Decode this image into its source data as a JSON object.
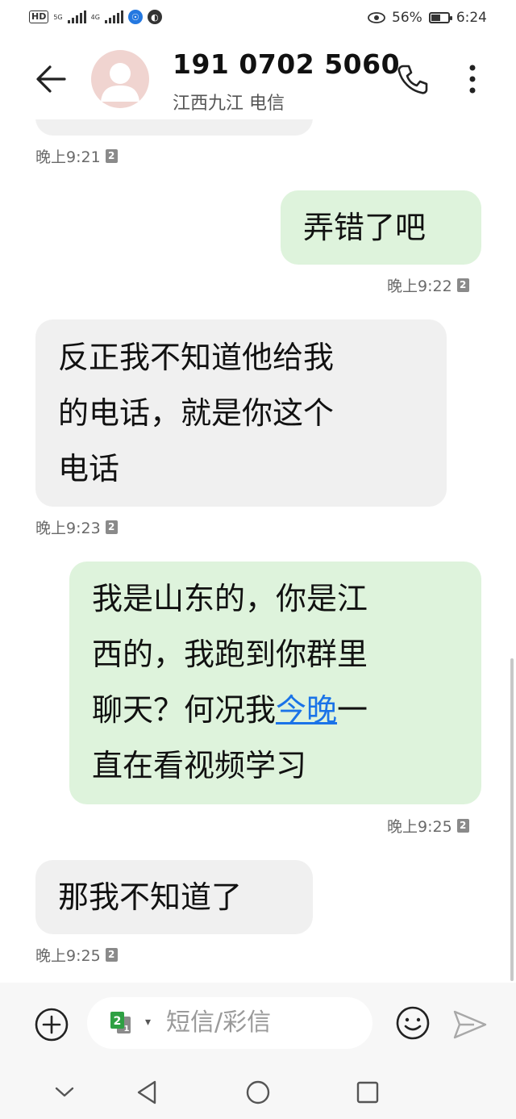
{
  "status_bar": {
    "hd": "HD",
    "net1": "5G",
    "net2": "4G",
    "battery_percent": "56%",
    "battery_level": 0.56,
    "time": "6:24"
  },
  "header": {
    "contact_number": "191 0702 5060",
    "contact_location": "江西九江 电信",
    "icons": [
      "back-arrow-icon",
      "avatar",
      "phone-icon",
      "more-vertical-icon"
    ]
  },
  "messages": [
    {
      "direction": "received",
      "text": "",
      "time": "晚上9:21",
      "sim": "2"
    },
    {
      "direction": "sent",
      "text": "弄错了吧",
      "time": "晚上9:22",
      "sim": "2"
    },
    {
      "direction": "received",
      "lines": [
        "反正我不知道他给我",
        "的电话，就是你这个",
        "电话"
      ],
      "time": "晚上9:23",
      "sim": "2"
    },
    {
      "direction": "sent",
      "lines": [
        "我是山东的，你是江",
        "西的，我跑到你群里",
        "聊天？何况我",
        "直在看视频学习"
      ],
      "link_text": "今晚",
      "after_link": "一",
      "time": "晚上9:25",
      "sim": "2"
    },
    {
      "direction": "received",
      "text": "那我不知道了",
      "time": "晚上9:25",
      "sim": "2"
    }
  ],
  "compose": {
    "sim_badge": "2",
    "sim_badge_secondary": "1",
    "placeholder": "短信/彩信",
    "icons": [
      "add-circle-icon",
      "sim-select-icon",
      "emoji-icon",
      "send-icon"
    ]
  },
  "navbar": {
    "icons": [
      "chevron-down-icon",
      "back-triangle-icon",
      "home-circle-icon",
      "recents-square-icon"
    ]
  },
  "colors": {
    "sent_bubble": "#def3dc",
    "received_bubble": "#f0f0f0",
    "link": "#1a73e8"
  }
}
